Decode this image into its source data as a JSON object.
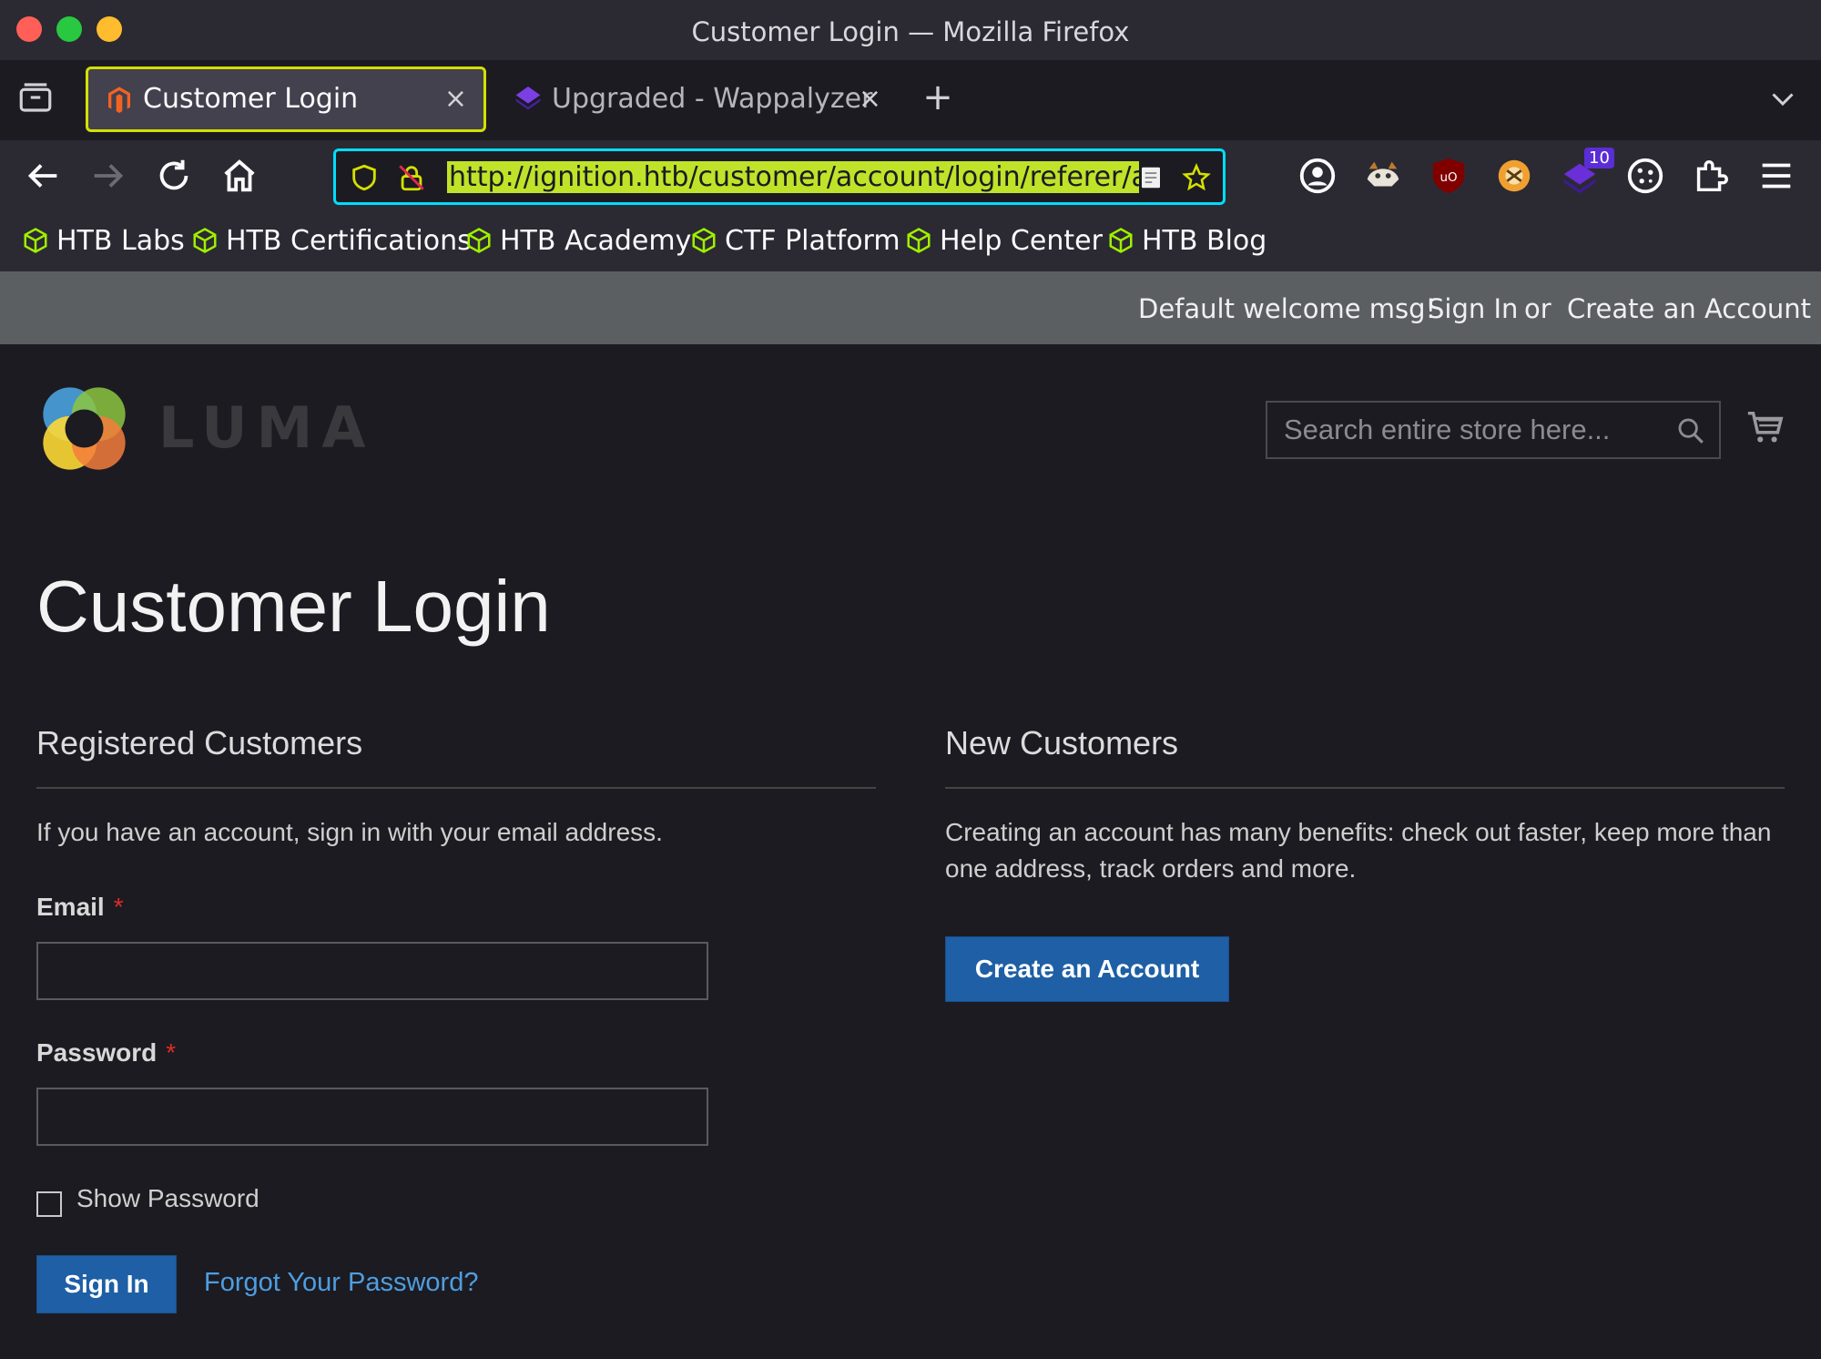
{
  "window": {
    "title": "Customer Login — Mozilla Firefox"
  },
  "tabs": [
    {
      "label": "Customer Login",
      "close": "×",
      "active": true
    },
    {
      "label": "Upgraded - Wappalyzer",
      "close": "×",
      "active": false
    }
  ],
  "new_tab": "+",
  "url": {
    "text": "http://ignition.htb/customer/account/login/referer/aHI"
  },
  "extensions": {
    "badge_count": "10"
  },
  "bookmarks": [
    {
      "label": "HTB Labs"
    },
    {
      "label": "HTB Certifications"
    },
    {
      "label": "HTB Academy"
    },
    {
      "label": "CTF Platform"
    },
    {
      "label": "Help Center"
    },
    {
      "label": "HTB Blog"
    }
  ],
  "header_links": {
    "welcome": "Default welcome msg!",
    "sign_in": "Sign In",
    "or": "or",
    "create_account": "Create an Account"
  },
  "logo": {
    "text": "LUMA"
  },
  "search": {
    "placeholder": "Search entire store here..."
  },
  "page": {
    "title": "Customer Login"
  },
  "registered": {
    "title": "Registered Customers",
    "intro": "If you have an account, sign in with your email address.",
    "email_label": "Email",
    "password_label": "Password",
    "required_mark": "*",
    "show_password": "Show Password",
    "sign_in_button": "Sign In",
    "forgot_link": "Forgot Your Password?"
  },
  "new_customers": {
    "title": "New Customers",
    "text": "Creating an account has many benefits: check out faster, keep more than one address, track orders and more.",
    "button": "Create an Account"
  },
  "colors": {
    "accent_focus": "#d4e000",
    "url_border": "#00ddff",
    "primary_button": "#1e5fa5",
    "link": "#4e9ee0",
    "required": "#e02b27"
  }
}
